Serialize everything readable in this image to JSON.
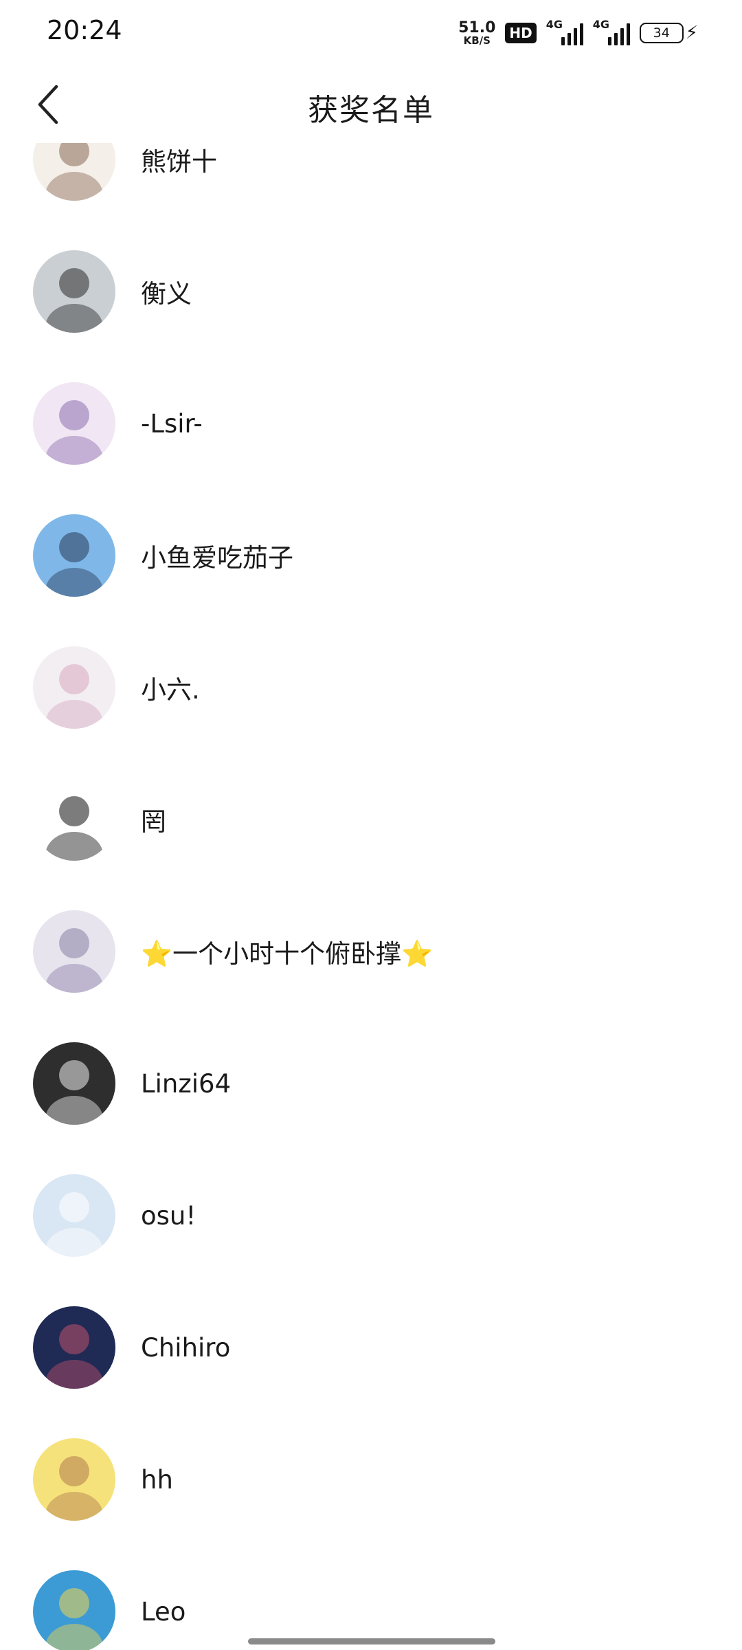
{
  "status_bar": {
    "time": "20:24",
    "net_speed_value": "51.0",
    "net_speed_unit": "KB/S",
    "hd_label": "HD",
    "sim1_label": "4G",
    "sim2_label": "4G",
    "battery_level": "34"
  },
  "header": {
    "title": "获奖名单",
    "back_icon": "chevron-left-icon"
  },
  "winners": [
    {
      "name": "熊饼十",
      "avatar_colors": [
        "#f4efe9",
        "#8a6a55"
      ]
    },
    {
      "name": "衡义",
      "avatar_colors": [
        "#c9cfd3",
        "#2b2b2b"
      ]
    },
    {
      "name": "-Lsir-",
      "avatar_colors": [
        "#f1e6f3",
        "#8c6fb0"
      ]
    },
    {
      "name": "小鱼爱吃茄子",
      "avatar_colors": [
        "#7fb8e8",
        "#2a3a5a"
      ]
    },
    {
      "name": "小六.",
      "avatar_colors": [
        "#f3eef2",
        "#d8a9c0"
      ]
    },
    {
      "name": "罔",
      "avatar_colors": [
        "#ffffff",
        "#111111"
      ]
    },
    {
      "name": "⭐一个小时十个俯卧撑⭐",
      "avatar_colors": [
        "#e7e4ee",
        "#8b7fa6"
      ]
    },
    {
      "name": "Linzi64",
      "avatar_colors": [
        "#2e2e2e",
        "#f1f1f1"
      ]
    },
    {
      "name": "osu!",
      "avatar_colors": [
        "#d9e6f4",
        "#ffffff"
      ]
    },
    {
      "name": "Chihiro",
      "avatar_colors": [
        "#1f2a55",
        "#c0506a"
      ]
    },
    {
      "name": "hh",
      "avatar_colors": [
        "#f6e27a",
        "#b07a50"
      ]
    },
    {
      "name": "Leo",
      "avatar_colors": [
        "#3c9bd4",
        "#f2d54a"
      ]
    }
  ]
}
